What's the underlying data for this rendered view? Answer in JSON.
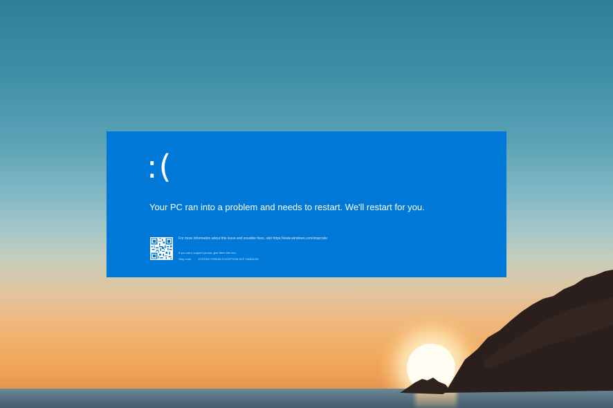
{
  "bsod": {
    "sad_face": ":(",
    "message": "Your PC ran into a problem and needs to restart. We'll restart for you.",
    "info": "For more information about this issue and possible fixes, visit https://www.windows.com/stopcode",
    "support": "If you call a support person, give them this info:",
    "stop_code_label": "Stop code:",
    "stop_code_value": "SYSTEM THREAD EXCEPTION NOT HANDLED"
  },
  "colors": {
    "bsod_blue": "#0078d7",
    "text": "#ffffff"
  },
  "icons": {
    "qr": "qr-code-icon"
  }
}
